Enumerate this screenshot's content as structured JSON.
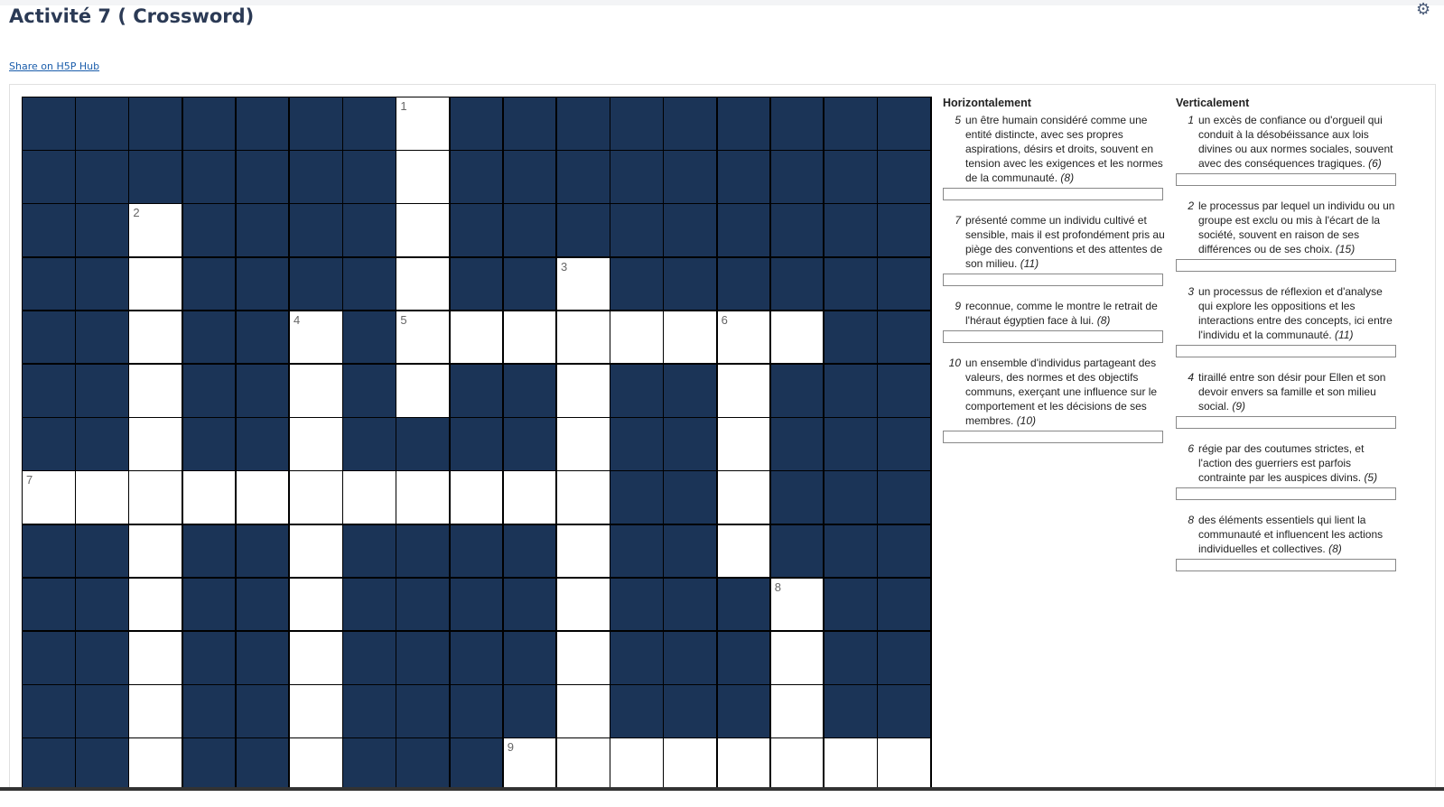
{
  "page": {
    "title": "Activité 7 ( Crossword)",
    "share_link": "Share on H5P Hub",
    "settings_icon": "gear-icon"
  },
  "colors": {
    "filled_cell": "#1b3457",
    "open_cell": "#ffffff",
    "title": "#2b3a55",
    "link": "#1a5dab"
  },
  "grid": {
    "cols": 17,
    "rows_visible": 13,
    "white_cells": [
      [
        0,
        7
      ],
      [
        1,
        7
      ],
      [
        2,
        2
      ],
      [
        2,
        7
      ],
      [
        3,
        2
      ],
      [
        3,
        7
      ],
      [
        3,
        10
      ],
      [
        4,
        2
      ],
      [
        4,
        5
      ],
      [
        4,
        7
      ],
      [
        4,
        8
      ],
      [
        4,
        9
      ],
      [
        4,
        10
      ],
      [
        4,
        11
      ],
      [
        4,
        12
      ],
      [
        4,
        13
      ],
      [
        4,
        14
      ],
      [
        5,
        2
      ],
      [
        5,
        5
      ],
      [
        5,
        7
      ],
      [
        5,
        10
      ],
      [
        5,
        13
      ],
      [
        6,
        2
      ],
      [
        6,
        5
      ],
      [
        6,
        10
      ],
      [
        6,
        13
      ],
      [
        7,
        0
      ],
      [
        7,
        1
      ],
      [
        7,
        2
      ],
      [
        7,
        3
      ],
      [
        7,
        4
      ],
      [
        7,
        5
      ],
      [
        7,
        6
      ],
      [
        7,
        7
      ],
      [
        7,
        8
      ],
      [
        7,
        9
      ],
      [
        7,
        10
      ],
      [
        7,
        13
      ],
      [
        8,
        2
      ],
      [
        8,
        5
      ],
      [
        8,
        10
      ],
      [
        8,
        13
      ],
      [
        9,
        2
      ],
      [
        9,
        5
      ],
      [
        9,
        10
      ],
      [
        9,
        14
      ],
      [
        10,
        2
      ],
      [
        10,
        5
      ],
      [
        10,
        10
      ],
      [
        10,
        14
      ],
      [
        11,
        2
      ],
      [
        11,
        5
      ],
      [
        11,
        10
      ],
      [
        11,
        14
      ],
      [
        12,
        2
      ],
      [
        12,
        5
      ],
      [
        12,
        9
      ],
      [
        12,
        10
      ],
      [
        12,
        11
      ],
      [
        12,
        12
      ],
      [
        12,
        13
      ],
      [
        12,
        14
      ],
      [
        12,
        15
      ],
      [
        12,
        16
      ]
    ],
    "numbers": [
      {
        "r": 0,
        "c": 7,
        "n": "1"
      },
      {
        "r": 2,
        "c": 2,
        "n": "2"
      },
      {
        "r": 3,
        "c": 10,
        "n": "3"
      },
      {
        "r": 4,
        "c": 5,
        "n": "4"
      },
      {
        "r": 4,
        "c": 7,
        "n": "5"
      },
      {
        "r": 4,
        "c": 13,
        "n": "6"
      },
      {
        "r": 7,
        "c": 0,
        "n": "7"
      },
      {
        "r": 9,
        "c": 14,
        "n": "8"
      },
      {
        "r": 12,
        "c": 9,
        "n": "9"
      }
    ]
  },
  "across": {
    "heading": "Horizontalement",
    "clues": [
      {
        "num": "5",
        "text": "un être humain considéré comme une entité distincte, avec ses propres aspirations, désirs et droits, souvent en tension avec les exigences et les normes de la communauté.",
        "len": "(8)",
        "placeholder": "_ _ _ _ _ _ _ _"
      },
      {
        "num": "7",
        "text": "présenté comme un individu cultivé et sensible, mais il est profondément pris au piège des conventions et des attentes de son milieu.",
        "len": "(11)",
        "placeholder": "_ _ _ _ _ _ _ _ _ _ _"
      },
      {
        "num": "9",
        "text": "reconnue, comme le montre le retrait de l'héraut égyptien face à lui.",
        "len": "(8)",
        "placeholder": "_ _ _ _ _ _ _ _"
      },
      {
        "num": "10",
        "text": "un ensemble d'individus partageant des valeurs, des normes et des objectifs communs, exerçant une influence sur le comportement et les décisions de ses membres.",
        "len": "(10)",
        "placeholder": "_ _ _ _ _ _ _ _ _ _"
      }
    ]
  },
  "down": {
    "heading": "Verticalement",
    "clues": [
      {
        "num": "1",
        "text": "un excès de confiance ou d'orgueil qui conduit à la désobéissance aux lois divines ou aux normes sociales, souvent avec des conséquences tragiques.",
        "len": "(6)",
        "placeholder": "_ _ _ _ _ _"
      },
      {
        "num": "2",
        "text": "le processus par lequel un individu ou un groupe est exclu ou mis à l'écart de la société, souvent en raison de ses différences ou de ses choix.",
        "len": "(15)",
        "placeholder": "_ _ _ _ _ _ _ _ _ _ _ _ _ _ _"
      },
      {
        "num": "3",
        "text": "un processus de réflexion et d'analyse qui explore les oppositions et les interactions entre des concepts, ici entre l'individu et la communauté.",
        "len": "(11)",
        "placeholder": "_ _ _ _ _ _ _ _ _ _ _"
      },
      {
        "num": "4",
        "text": "tiraillé entre son désir pour Ellen et son devoir envers sa famille et son milieu social.",
        "len": "(9)",
        "placeholder": "_ _ _ _ _ _ _ _ _"
      },
      {
        "num": "6",
        "text": "régie par des coutumes strictes, et l'action des guerriers est parfois contrainte par les auspices divins.",
        "len": "(5)",
        "placeholder": "_ _ _ _ _"
      },
      {
        "num": "8",
        "text": "des éléments essentiels qui lient la communauté et influencent les actions individuelles et collectives.",
        "len": "(8)",
        "placeholder": "_ _ _ _ _ _ _ _"
      }
    ]
  }
}
